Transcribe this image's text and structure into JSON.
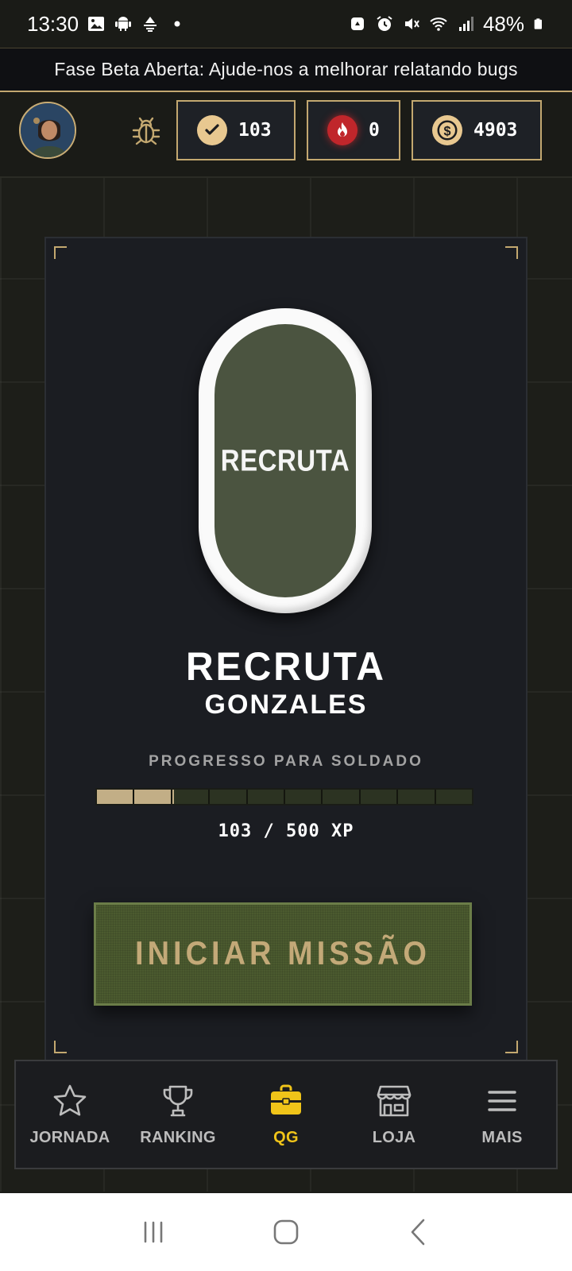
{
  "status_bar": {
    "time": "13:30",
    "battery": "48%"
  },
  "beta_banner": {
    "text": "Fase Beta Aberta: Ajude-nos a melhorar relatando bugs"
  },
  "header": {
    "avatar_icon": "avatar",
    "bug_icon": "bug-icon",
    "stats": {
      "missions": "103",
      "streak": "0",
      "coins": "4903"
    }
  },
  "card": {
    "badge_label": "RECRUTA",
    "rank_title": "RECRUTA",
    "player_name": "GONZALES",
    "progress_label": "PROGRESSO PARA SOLDADO",
    "xp_text": "103 / 500 XP",
    "xp_progress": 0.206,
    "progress_segments": 10,
    "mission_button": "INICIAR MISSÃO"
  },
  "nav": {
    "items": [
      {
        "label": "JORNADA",
        "icon": "star-icon"
      },
      {
        "label": "RANKING",
        "icon": "trophy-icon"
      },
      {
        "label": "QG",
        "icon": "briefcase-icon"
      },
      {
        "label": "LOJA",
        "icon": "store-icon"
      },
      {
        "label": "MAIS",
        "icon": "menu-icon"
      }
    ],
    "active": "QG"
  },
  "colors": {
    "accent_gold": "#c3a870",
    "active_nav": "#f0c419",
    "badge_green": "#4b5440",
    "button_green": "#4b5a2f"
  }
}
